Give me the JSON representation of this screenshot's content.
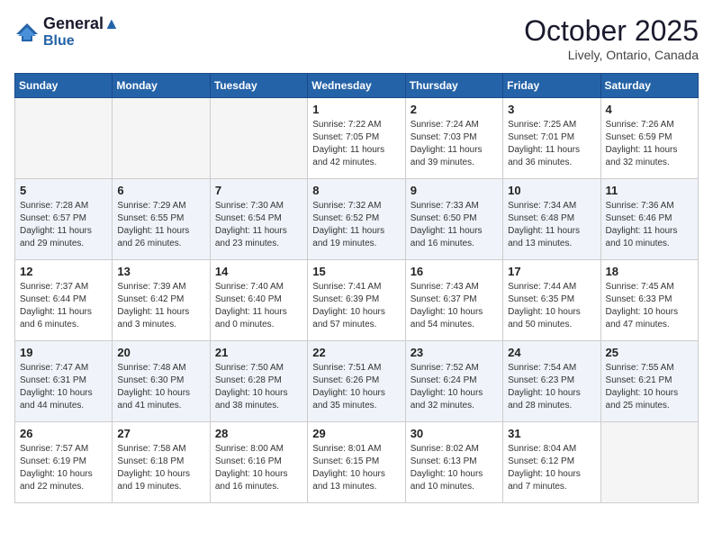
{
  "header": {
    "logo_line1": "General",
    "logo_line2": "Blue",
    "month": "October 2025",
    "location": "Lively, Ontario, Canada"
  },
  "weekdays": [
    "Sunday",
    "Monday",
    "Tuesday",
    "Wednesday",
    "Thursday",
    "Friday",
    "Saturday"
  ],
  "weeks": [
    [
      {
        "day": "",
        "content": ""
      },
      {
        "day": "",
        "content": ""
      },
      {
        "day": "",
        "content": ""
      },
      {
        "day": "1",
        "content": "Sunrise: 7:22 AM\nSunset: 7:05 PM\nDaylight: 11 hours\nand 42 minutes."
      },
      {
        "day": "2",
        "content": "Sunrise: 7:24 AM\nSunset: 7:03 PM\nDaylight: 11 hours\nand 39 minutes."
      },
      {
        "day": "3",
        "content": "Sunrise: 7:25 AM\nSunset: 7:01 PM\nDaylight: 11 hours\nand 36 minutes."
      },
      {
        "day": "4",
        "content": "Sunrise: 7:26 AM\nSunset: 6:59 PM\nDaylight: 11 hours\nand 32 minutes."
      }
    ],
    [
      {
        "day": "5",
        "content": "Sunrise: 7:28 AM\nSunset: 6:57 PM\nDaylight: 11 hours\nand 29 minutes."
      },
      {
        "day": "6",
        "content": "Sunrise: 7:29 AM\nSunset: 6:55 PM\nDaylight: 11 hours\nand 26 minutes."
      },
      {
        "day": "7",
        "content": "Sunrise: 7:30 AM\nSunset: 6:54 PM\nDaylight: 11 hours\nand 23 minutes."
      },
      {
        "day": "8",
        "content": "Sunrise: 7:32 AM\nSunset: 6:52 PM\nDaylight: 11 hours\nand 19 minutes."
      },
      {
        "day": "9",
        "content": "Sunrise: 7:33 AM\nSunset: 6:50 PM\nDaylight: 11 hours\nand 16 minutes."
      },
      {
        "day": "10",
        "content": "Sunrise: 7:34 AM\nSunset: 6:48 PM\nDaylight: 11 hours\nand 13 minutes."
      },
      {
        "day": "11",
        "content": "Sunrise: 7:36 AM\nSunset: 6:46 PM\nDaylight: 11 hours\nand 10 minutes."
      }
    ],
    [
      {
        "day": "12",
        "content": "Sunrise: 7:37 AM\nSunset: 6:44 PM\nDaylight: 11 hours\nand 6 minutes."
      },
      {
        "day": "13",
        "content": "Sunrise: 7:39 AM\nSunset: 6:42 PM\nDaylight: 11 hours\nand 3 minutes."
      },
      {
        "day": "14",
        "content": "Sunrise: 7:40 AM\nSunset: 6:40 PM\nDaylight: 11 hours\nand 0 minutes."
      },
      {
        "day": "15",
        "content": "Sunrise: 7:41 AM\nSunset: 6:39 PM\nDaylight: 10 hours\nand 57 minutes."
      },
      {
        "day": "16",
        "content": "Sunrise: 7:43 AM\nSunset: 6:37 PM\nDaylight: 10 hours\nand 54 minutes."
      },
      {
        "day": "17",
        "content": "Sunrise: 7:44 AM\nSunset: 6:35 PM\nDaylight: 10 hours\nand 50 minutes."
      },
      {
        "day": "18",
        "content": "Sunrise: 7:45 AM\nSunset: 6:33 PM\nDaylight: 10 hours\nand 47 minutes."
      }
    ],
    [
      {
        "day": "19",
        "content": "Sunrise: 7:47 AM\nSunset: 6:31 PM\nDaylight: 10 hours\nand 44 minutes."
      },
      {
        "day": "20",
        "content": "Sunrise: 7:48 AM\nSunset: 6:30 PM\nDaylight: 10 hours\nand 41 minutes."
      },
      {
        "day": "21",
        "content": "Sunrise: 7:50 AM\nSunset: 6:28 PM\nDaylight: 10 hours\nand 38 minutes."
      },
      {
        "day": "22",
        "content": "Sunrise: 7:51 AM\nSunset: 6:26 PM\nDaylight: 10 hours\nand 35 minutes."
      },
      {
        "day": "23",
        "content": "Sunrise: 7:52 AM\nSunset: 6:24 PM\nDaylight: 10 hours\nand 32 minutes."
      },
      {
        "day": "24",
        "content": "Sunrise: 7:54 AM\nSunset: 6:23 PM\nDaylight: 10 hours\nand 28 minutes."
      },
      {
        "day": "25",
        "content": "Sunrise: 7:55 AM\nSunset: 6:21 PM\nDaylight: 10 hours\nand 25 minutes."
      }
    ],
    [
      {
        "day": "26",
        "content": "Sunrise: 7:57 AM\nSunset: 6:19 PM\nDaylight: 10 hours\nand 22 minutes."
      },
      {
        "day": "27",
        "content": "Sunrise: 7:58 AM\nSunset: 6:18 PM\nDaylight: 10 hours\nand 19 minutes."
      },
      {
        "day": "28",
        "content": "Sunrise: 8:00 AM\nSunset: 6:16 PM\nDaylight: 10 hours\nand 16 minutes."
      },
      {
        "day": "29",
        "content": "Sunrise: 8:01 AM\nSunset: 6:15 PM\nDaylight: 10 hours\nand 13 minutes."
      },
      {
        "day": "30",
        "content": "Sunrise: 8:02 AM\nSunset: 6:13 PM\nDaylight: 10 hours\nand 10 minutes."
      },
      {
        "day": "31",
        "content": "Sunrise: 8:04 AM\nSunset: 6:12 PM\nDaylight: 10 hours\nand 7 minutes."
      },
      {
        "day": "",
        "content": ""
      }
    ]
  ]
}
